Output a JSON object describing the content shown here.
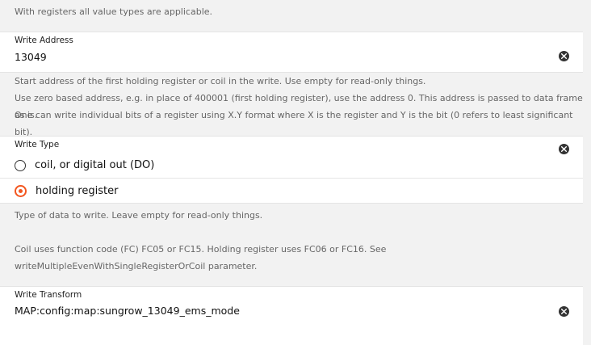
{
  "top_hint": "With registers all value types are applicable.",
  "write_address": {
    "label": "Write Address",
    "value": "13049",
    "hints": [
      "Start address of the first holding register or coil in the write. Use empty for read-only things.",
      "Use zero based address, e.g. in place of 400001 (first holding register), use the address 0. This address is passed to data frame as is.",
      "One can write individual bits of a register using X.Y format where X is the register and Y is the bit (0 refers to least significant bit)."
    ]
  },
  "write_type": {
    "label": "Write Type",
    "options": [
      {
        "label": "coil, or digital out (DO)",
        "selected": false
      },
      {
        "label": "holding register",
        "selected": true
      }
    ],
    "hints": [
      "Type of data to write. Leave empty for read-only things.",
      "Coil uses function code (FC) FC05 or FC15. Holding register uses FC06 or FC16. See writeMultipleEvenWithSingleRegisterOrCoil parameter."
    ]
  },
  "write_transform": {
    "label": "Write Transform",
    "value": "MAP:config:map:sungrow_13049_ems_mode"
  },
  "colors": {
    "accent": "#f3561f",
    "background": "#f2f2f2",
    "card": "#ffffff"
  },
  "icons": {
    "clear": "close-circle-icon"
  }
}
